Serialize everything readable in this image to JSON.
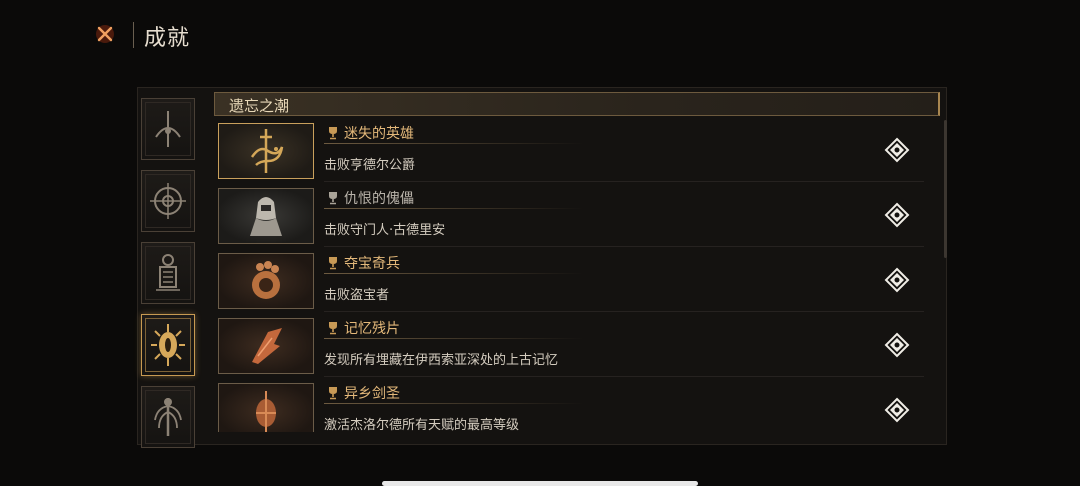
{
  "header": {
    "title": "成就",
    "close_icon": "close-x-icon"
  },
  "categories": [
    {
      "icon": "abyss-eye-icon",
      "active": false
    },
    {
      "icon": "compass-sigil-icon",
      "active": false
    },
    {
      "icon": "lantern-totem-icon",
      "active": false
    },
    {
      "icon": "radiant-eye-icon",
      "active": true
    },
    {
      "icon": "tentacle-idol-icon",
      "active": false
    }
  ],
  "section": {
    "title": "遗忘之潮"
  },
  "achievements": [
    {
      "name": "迷失的英雄",
      "desc": "击败亨德尔公爵",
      "tone": "gold",
      "icon": "sword-dragon-icon"
    },
    {
      "name": "仇恨的傀儡",
      "desc": "击败守门人·古德里安",
      "tone": "grey",
      "icon": "hooded-golem-icon"
    },
    {
      "name": "夺宝奇兵",
      "desc": "击败盗宝者",
      "tone": "gold",
      "icon": "treasure-hand-icon"
    },
    {
      "name": "记忆残片",
      "desc": "发现所有埋藏在伊西索亚深处的上古记忆",
      "tone": "gold",
      "icon": "memory-shard-icon"
    },
    {
      "name": "异乡剑圣",
      "desc": "激活杰洛尔德所有天赋的最高等级",
      "tone": "gold",
      "icon": "sword-saint-icon"
    }
  ],
  "colors": {
    "accent_gold": "#c9a05c",
    "background": "#0b0a09",
    "panel": "#141210"
  }
}
